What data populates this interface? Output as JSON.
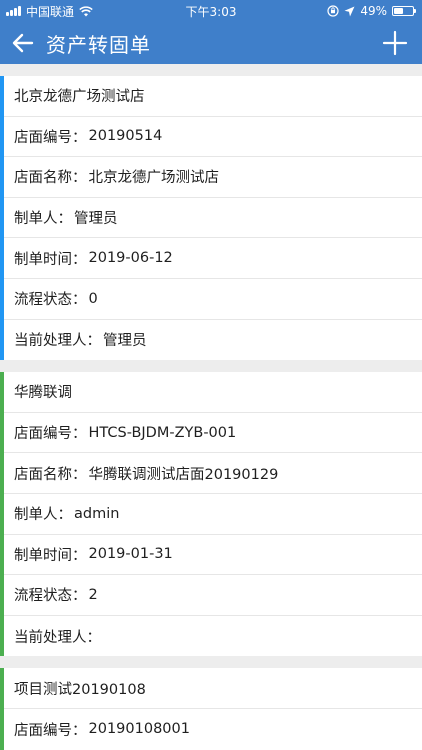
{
  "status_bar": {
    "carrier": "中国联通",
    "time": "下午3:03",
    "battery": "49%",
    "battery_level": 0.49
  },
  "nav": {
    "title": "资产转固单"
  },
  "colors": {
    "primary": "#3f7fca",
    "accent_blue": "#2196f3",
    "accent_green": "#4caf50"
  },
  "labels": {
    "store_code": "店面编号：",
    "store_name": "店面名称：",
    "creator": "制单人：",
    "create_time": "制单时间：",
    "flow_status": "流程状态：",
    "handler": "当前处理人："
  },
  "records": [
    {
      "title": "北京龙德广场测试店",
      "store_code": "20190514",
      "store_name": "北京龙德广场测试店",
      "creator": "管理员",
      "create_time": "2019-06-12",
      "flow_status": "0",
      "handler": "管理员"
    },
    {
      "title": "华腾联调",
      "store_code": "HTCS-BJDM-ZYB-001",
      "store_name": "华腾联调测试店面20190129",
      "creator": "admin",
      "create_time": "2019-01-31",
      "flow_status": "2",
      "handler": ""
    },
    {
      "title": "项目测试20190108",
      "store_code": "20190108001"
    }
  ]
}
